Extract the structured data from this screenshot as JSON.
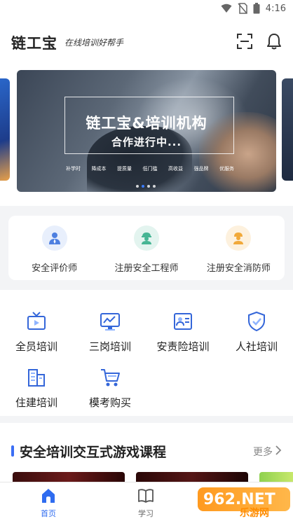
{
  "status_bar": {
    "time": "4:16"
  },
  "header": {
    "logo": "链工宝",
    "slogan": "在线培训好帮手"
  },
  "banner": {
    "title": "链工宝&培训机构",
    "subtitle": "合作进行中...",
    "tags": [
      "补学时",
      "降成本",
      "提质量",
      "低门槛",
      "高收益",
      "强品牌",
      "优服务"
    ]
  },
  "roles": [
    {
      "label": "安全评价师",
      "icon": "evaluator-icon",
      "bg": "#e8effc",
      "fg": "#4d7fe0"
    },
    {
      "label": "注册安全工程师",
      "icon": "engineer-icon",
      "bg": "#e3f4ef",
      "fg": "#46b594"
    },
    {
      "label": "注册安全消防师",
      "icon": "firefighter-icon",
      "bg": "#fdf1de",
      "fg": "#f1a93a"
    }
  ],
  "menu": [
    {
      "label": "全员培训",
      "icon": "tv-icon"
    },
    {
      "label": "三岗培训",
      "icon": "monitor-chart-icon"
    },
    {
      "label": "安责险培训",
      "icon": "id-card-icon"
    },
    {
      "label": "人社培训",
      "icon": "shield-check-icon"
    },
    {
      "label": "住建培训",
      "icon": "building-icon"
    },
    {
      "label": "模考购买",
      "icon": "cart-icon"
    }
  ],
  "section": {
    "title": "安全培训交互式游戏课程",
    "more": "更多"
  },
  "bottom_nav": [
    {
      "label": "首页",
      "icon": "home-icon",
      "active": true
    },
    {
      "label": "学习",
      "icon": "book-icon",
      "active": false
    }
  ],
  "watermark": {
    "badge": "962.NET",
    "sub": "乐游网"
  },
  "colors": {
    "accent": "#2f6cf0",
    "section_bar": "#3b6ef5",
    "watermark": "#ff9a1f"
  }
}
